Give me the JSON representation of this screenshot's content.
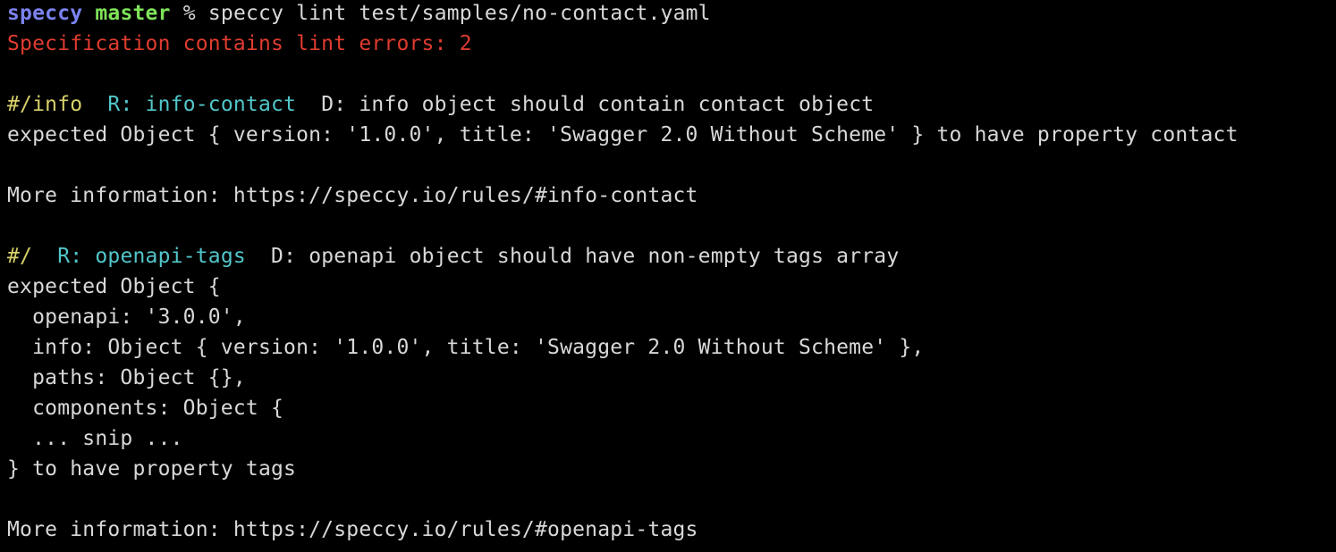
{
  "prompt": {
    "user": "speccy",
    "branch": "master",
    "symbol": "%",
    "command": "speccy lint test/samples/no-contact.yaml"
  },
  "summary": "Specification contains lint errors: 2",
  "errors": [
    {
      "path": "#/info",
      "rule_label": "R: info-contact",
      "description": "D: info object should contain contact object",
      "detail": [
        "expected Object { version: '1.0.0', title: 'Swagger 2.0 Without Scheme' } to have property contact"
      ],
      "more_info": "More information: https://speccy.io/rules/#info-contact"
    },
    {
      "path": "#/",
      "rule_label": "R: openapi-tags",
      "description": "D: openapi object should have non-empty tags array",
      "detail": [
        "expected Object {",
        "  openapi: '3.0.0',",
        "  info: Object { version: '1.0.0', title: 'Swagger 2.0 Without Scheme' },",
        "  paths: Object {},",
        "  components: Object {",
        "  ... snip ...",
        "} to have property tags"
      ],
      "more_info": "More information: https://speccy.io/rules/#openapi-tags"
    }
  ],
  "colors": {
    "background": "#000000",
    "text": "#d8d8d8",
    "user": "#7b83f0",
    "branch": "#7fe25a",
    "error": "#e03c2f",
    "path": "#d8d06a",
    "rule": "#52c6c9"
  }
}
